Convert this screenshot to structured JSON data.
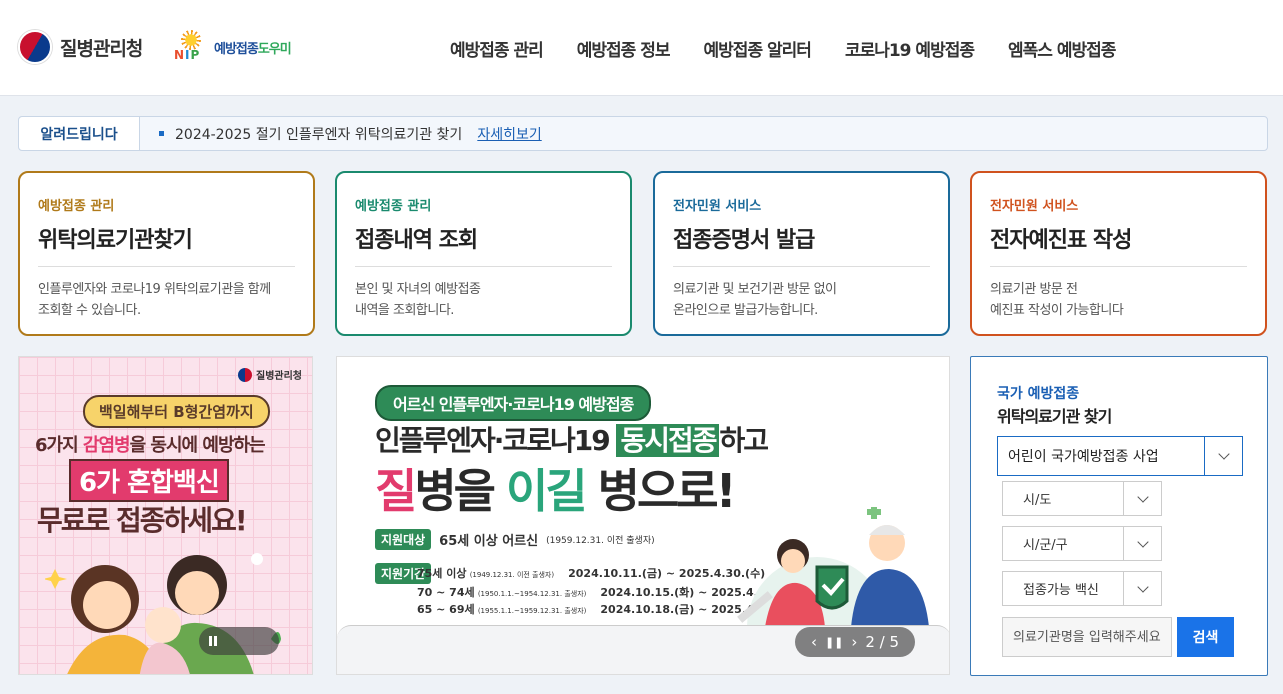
{
  "header": {
    "logo_kdca": "질병관리청",
    "logo_nip_mark": [
      "N",
      "I",
      "P"
    ],
    "logo_nip_text_a": "예방접종",
    "logo_nip_text_b": "도우미",
    "gnb": [
      "예방접종 관리",
      "예방접종 정보",
      "예방접종 알리터",
      "코로나19 예방접종",
      "엠폭스 예방접종"
    ]
  },
  "notice": {
    "label": "알려드립니다",
    "text": "2024-2025 절기 인플루엔자 위탁의료기관 찾기",
    "link": "자세히보기"
  },
  "cards": [
    {
      "category": "예방접종 관리",
      "title": "위탁의료기관찾기",
      "desc": "인플루엔자와 코로나19 위탁의료기관을 함께\n조회할 수 있습니다.",
      "color": "#b07a1a"
    },
    {
      "category": "예방접종 관리",
      "title": "접종내역 조회",
      "desc": "본인 및 자녀의 예방접종\n내역을 조회합니다.",
      "color": "#1a8a6e"
    },
    {
      "category": "전자민원 서비스",
      "title": "접종증명서 발급",
      "desc": "의료기관 및 보건기관 방문 없이\n온라인으로 발급가능합니다.",
      "color": "#1a6a9a"
    },
    {
      "category": "전자민원 서비스",
      "title": "전자예진표 작성",
      "desc": "의료기관 방문 전\n예진표 작성이 가능합니다",
      "color": "#d0521e"
    }
  ],
  "banner_left": {
    "logo": "질병관리청",
    "line1": "백일해부터 B형간염까지",
    "line2_a": "6가지 ",
    "line2_b": "감염병",
    "line2_c": "을 동시에 예방하는",
    "line3": "6가 혼합백신",
    "line4": "무료로 접종하세요!"
  },
  "banner_center": {
    "pill": "어르신 인플루엔자·코로나19 예방접종",
    "line2_a": "인플루엔자·코로나19 ",
    "line2_b": "동시접종",
    "line2_c": "하고",
    "line3_a": "질",
    "line3_b": "병을 ",
    "line3_c": "이길",
    "line3_d": " 병으로!",
    "target_tag": "지원대상",
    "target_text": "65세 이상 어르신",
    "target_note": "(1959.12.31. 이전 출생자)",
    "period_tag": "지원기간",
    "periods": [
      {
        "age": "75세 이상",
        "born": "(1949.12.31. 이전 출생자)",
        "range": "2024.10.11.(금) ~ 2025.4.30.(수)"
      },
      {
        "age": "70 ~ 74세",
        "born": "(1950.1.1.~1954.12.31. 출생자)",
        "range": "2024.10.15.(화) ~ 2025.4.30.(수)"
      },
      {
        "age": "65 ~ 69세",
        "born": "(1955.1.1.~1959.12.31. 출생자)",
        "range": "2024.10.18.(금) ~ 2025.4.30.(수)"
      }
    ],
    "pager": "2 / 5"
  },
  "search": {
    "subtitle": "국가 예방접종",
    "title": "위탁의료기관 찾기",
    "program": "어린이 국가예방접종 사업",
    "sido": "시/도",
    "sigungu": "시/군/구",
    "vaccine": "접종가능 백신",
    "input_placeholder": "의료기관명을 입력해주세요",
    "button": "검색"
  }
}
